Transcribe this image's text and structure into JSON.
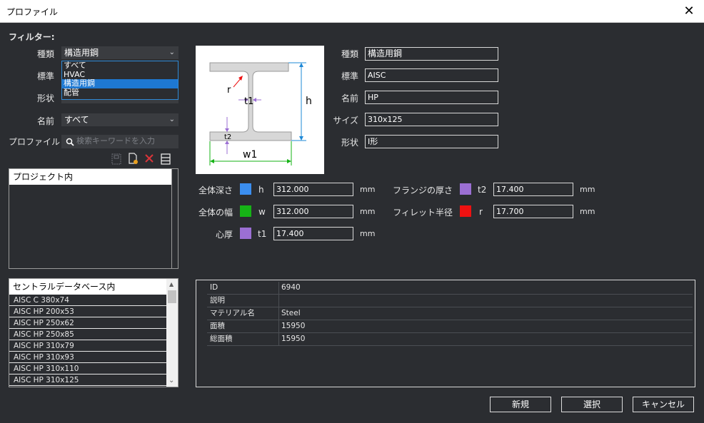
{
  "window": {
    "title": "プロファイル",
    "close": "✕"
  },
  "filter": {
    "heading": "フィルター:",
    "kind_label": "種類",
    "kind_value": "構造用鋼",
    "standard_label": "標準",
    "shape_label": "形状",
    "name_label": "名前",
    "name_value": "すべて",
    "dropdown_options": [
      "すべて",
      "HVAC",
      "構造用鋼",
      "配管"
    ],
    "profile_label": "プロファイル",
    "search_placeholder": "検索キーワードを入力"
  },
  "project_list": {
    "header": "プロジェクト内"
  },
  "central_list": {
    "header": "セントラルデータベース内",
    "items": [
      "AISC C 380x74",
      "AISC HP 200x53",
      "AISC HP 250x62",
      "AISC HP 250x85",
      "AISC HP 310x79",
      "AISC HP 310x93",
      "AISC HP 310x110",
      "AISC HP 310x125"
    ]
  },
  "diagram": {
    "r": "r",
    "t1": "t1",
    "t2": "t2",
    "h": "h",
    "w1": "w1"
  },
  "info": {
    "kind_label": "種類",
    "kind_value": "構造用鋼",
    "standard_label": "標準",
    "standard_value": "AISC",
    "name_label": "名前",
    "name_value": "HP",
    "size_label": "サイズ",
    "size_value": "310x125",
    "shape_label": "形状",
    "shape_value": "I形"
  },
  "dims": {
    "depth": {
      "label": "全体深さ",
      "sym": "h",
      "value": "312.000",
      "unit": "mm",
      "color": "#3b8ef0"
    },
    "width": {
      "label": "全体の幅",
      "sym": "w",
      "value": "312.000",
      "unit": "mm",
      "color": "#16b316"
    },
    "web": {
      "label": "心厚",
      "sym": "t1",
      "value": "17.400",
      "unit": "mm",
      "color": "#9b6fd3"
    },
    "flange": {
      "label": "フランジの厚さ",
      "sym": "t2",
      "value": "17.400",
      "unit": "mm",
      "color": "#9b6fd3"
    },
    "fillet": {
      "label": "フィレット半径",
      "sym": "r",
      "value": "17.700",
      "unit": "mm",
      "color": "#ee1111"
    }
  },
  "props": [
    {
      "k": "ID",
      "v": "6940"
    },
    {
      "k": "説明",
      "v": ""
    },
    {
      "k": "マテリアル名",
      "v": "Steel"
    },
    {
      "k": "面積",
      "v": "15950"
    },
    {
      "k": "総面積",
      "v": "15950"
    }
  ],
  "buttons": {
    "new": "新規",
    "select": "選択",
    "cancel": "キャンセル"
  }
}
